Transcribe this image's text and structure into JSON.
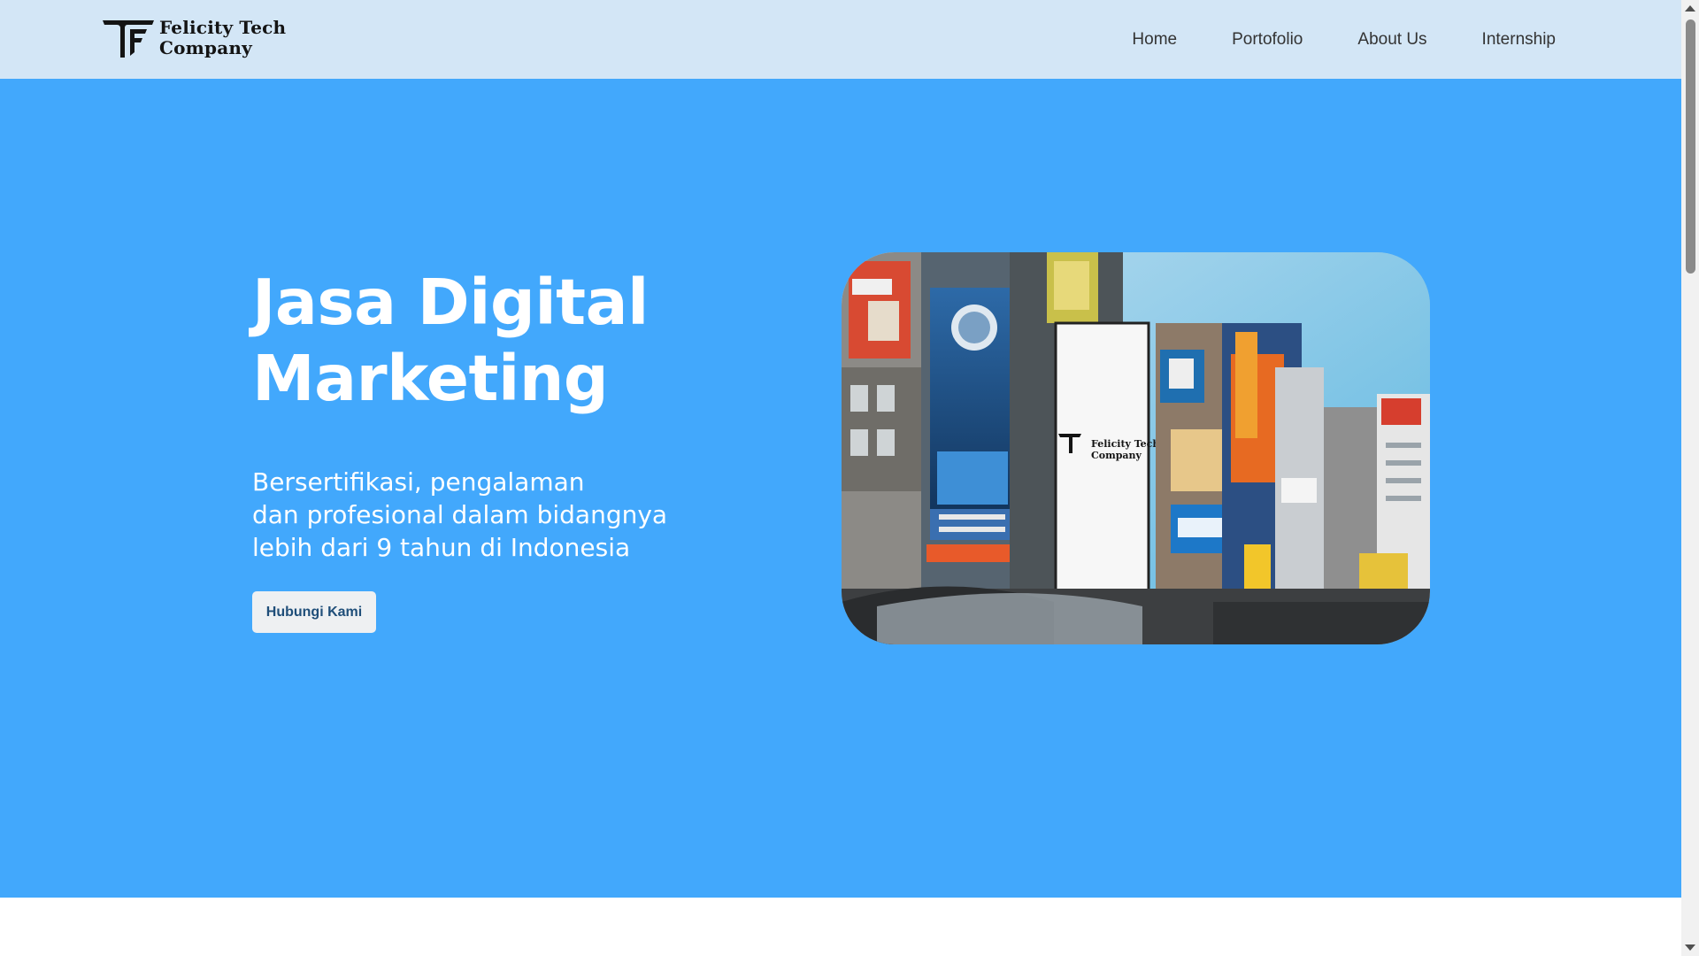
{
  "brand": {
    "name_line1": "Felicity Tech",
    "name_line2": "Company",
    "logo_icon": "tf-monogram-logo"
  },
  "nav": {
    "items": [
      {
        "label": "Home"
      },
      {
        "label": "Portofolio"
      },
      {
        "label": "About Us"
      },
      {
        "label": "Internship"
      }
    ]
  },
  "hero": {
    "title_line1": "Jasa Digital",
    "title_line2": "Marketing",
    "subtitle_line1": "Bersertifikasi, pengalaman",
    "subtitle_line2": "dan profesional dalam bidangnya",
    "subtitle_line3": "lebih dari 9 tahun di Indonesia",
    "cta_label": "Hubungi Kami",
    "image": {
      "billboard_text_line1": "Felicity Tech",
      "billboard_text_line2": "Company"
    }
  },
  "colors": {
    "navbar_bg": "#d3e6f6",
    "hero_bg": "#42a8fc",
    "text_light": "#ffffff",
    "cta_bg": "#eef0f2",
    "cta_text": "#1f4e79"
  }
}
